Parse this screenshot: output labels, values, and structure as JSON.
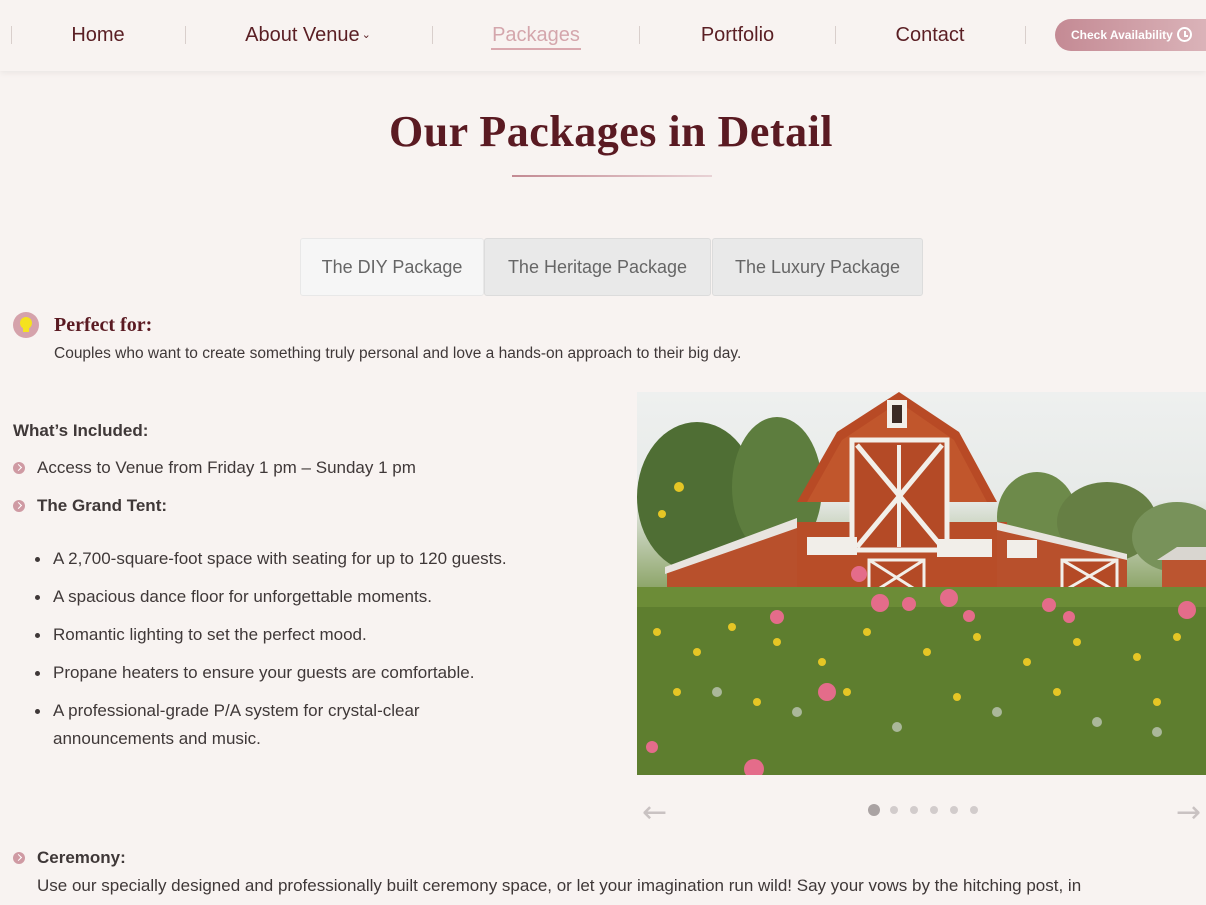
{
  "nav": {
    "items": [
      {
        "label": "Home"
      },
      {
        "label": "About Venue",
        "has_caret": true
      },
      {
        "label": "Packages",
        "active": true
      },
      {
        "label": "Portfolio"
      },
      {
        "label": "Contact"
      }
    ],
    "cta_label": "Check Availability",
    "caret": "⌄"
  },
  "heading": {
    "title": "Our Packages in Detail"
  },
  "tabs": [
    {
      "label": "The DIY Package",
      "active": true
    },
    {
      "label": "The Heritage Package"
    },
    {
      "label": "The Luxury Package"
    }
  ],
  "perfect_for": {
    "title": "Perfect for:",
    "text": "Couples who want to create something truly personal and love a hands-on approach to their big day."
  },
  "included": {
    "label": "What’s Included:",
    "access": "Access to Venue from Friday 1 pm – Sunday 1 pm",
    "grand_tent": "The Grand Tent:",
    "tent_items": [
      "A 2,700-square-foot space with seating for up to 120 guests.",
      "A spacious dance floor for unforgettable moments.",
      "Romantic lighting to set the perfect mood.",
      "Propane heaters to ensure your guests are comfortable.",
      "A professional-grade P/A system for crystal-clear announcements and music."
    ]
  },
  "carousel": {
    "prev": "←",
    "next": "→",
    "slide_count": 6,
    "active_index": 0
  },
  "ceremony": {
    "label": "Ceremony:",
    "text": "Use our specially designed and professionally built ceremony space, or let your imagination run wild! Say your vows by the hitching post, in"
  },
  "colors": {
    "accent": "#5a1a22",
    "brand_pink": "#cf9aa3",
    "background": "#f8f3f1"
  }
}
